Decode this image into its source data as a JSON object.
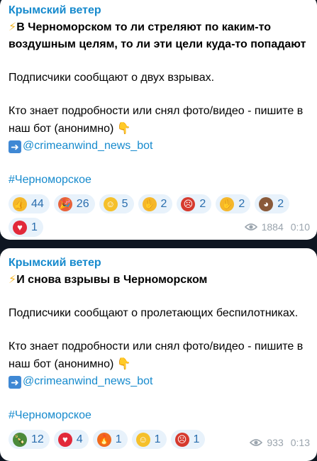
{
  "posts": [
    {
      "channel": "Крымский ветер",
      "headline": "В Черноморском то ли стреляют по каким-то воздушным целям, то ли эти цели куда-то попадают",
      "body": "Подписчики сообщают о двух взрывах.",
      "cta": "Кто знает подробности или снял фото/видео - пишите в наш бот (анонимно)",
      "bot_link": "@crimeanwind_news_bot",
      "hashtag": "#Черноморское",
      "reactions": [
        {
          "icon": "thumbs-up",
          "count": "44",
          "color": "#f5b72b"
        },
        {
          "icon": "party-popper",
          "count": "26",
          "color": "#e8623a"
        },
        {
          "icon": "grinning-face",
          "count": "5",
          "color": "#f5c02b"
        },
        {
          "icon": "clapping-hands",
          "count": "2",
          "color": "#f5b72b"
        },
        {
          "icon": "angry-face",
          "count": "2",
          "color": "#d63a2e"
        },
        {
          "icon": "folded-hands",
          "count": "2",
          "color": "#f5b72b"
        },
        {
          "icon": "see-no-evil-monkey",
          "count": "2",
          "color": "#8a5a3a"
        },
        {
          "icon": "red-heart",
          "count": "1",
          "color": "#e2293a"
        }
      ],
      "views": "1884",
      "time": "0:10"
    },
    {
      "channel": "Крымский ветер",
      "headline": "И снова взрывы в Черноморском",
      "body": "Подписчики сообщают о пролетающих беспилотниках.",
      "cta": "Кто знает подробности или снял фото/видео - пишите в наш бот (анонимно)",
      "bot_link": "@crimeanwind_news_bot",
      "hashtag": "#Черноморское",
      "reactions": [
        {
          "icon": "champagne-bottle",
          "count": "12",
          "color": "#4a8a3a"
        },
        {
          "icon": "red-heart",
          "count": "4",
          "color": "#e2293a"
        },
        {
          "icon": "fire",
          "count": "1",
          "color": "#f06a1e"
        },
        {
          "icon": "grinning-face",
          "count": "1",
          "color": "#f5c02b"
        },
        {
          "icon": "angry-face",
          "count": "1",
          "color": "#d63a2e"
        }
      ],
      "views": "933",
      "time": "0:13"
    }
  ]
}
